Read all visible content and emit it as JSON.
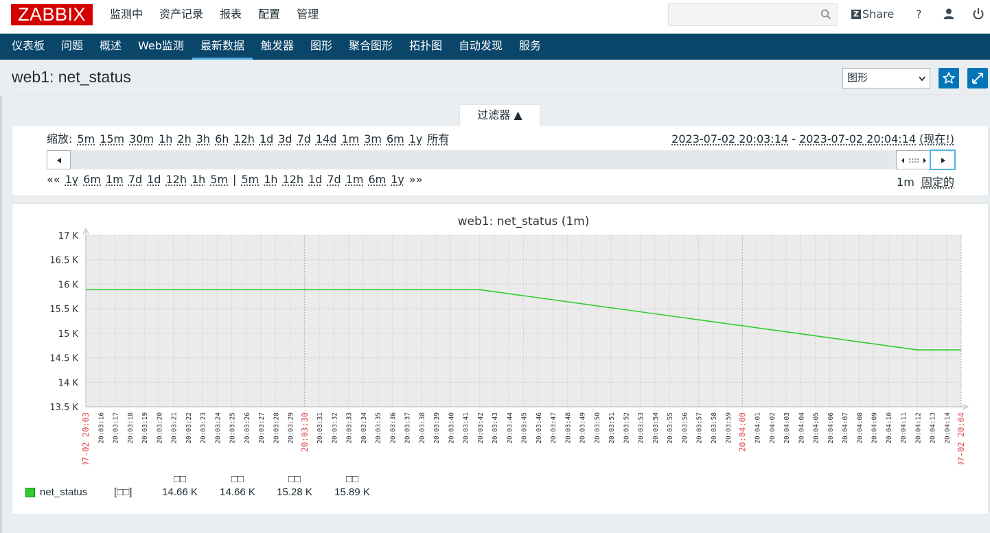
{
  "header": {
    "logo": "ZABBIX",
    "nav": [
      "监测中",
      "资产记录",
      "报表",
      "配置",
      "管理"
    ],
    "active_nav": "监测中",
    "search_placeholder": "",
    "share_label": "Share",
    "share_badge": "Z",
    "help_label": "?"
  },
  "subnav": {
    "items": [
      "仪表板",
      "问题",
      "概述",
      "Web监测",
      "最新数据",
      "触发器",
      "图形",
      "聚合图形",
      "拓扑图",
      "自动发现",
      "服务"
    ],
    "active": "最新数据"
  },
  "page": {
    "title": "web1: net_status",
    "view_select": "图形",
    "view_options": [
      "图形"
    ]
  },
  "filter": {
    "tab_label": "过滤器 ▲",
    "zoom_label": "缩放:",
    "zoom_options": [
      "5m",
      "15m",
      "30m",
      "1h",
      "2h",
      "3h",
      "6h",
      "12h",
      "1d",
      "3d",
      "7d",
      "14d",
      "1m",
      "3m",
      "6m",
      "1y",
      "所有"
    ],
    "range_from": "2023-07-02 20:03:14",
    "range_sep": "-",
    "range_to": "2023-07-02 20:04:14",
    "range_now": "(现在!)",
    "nav_back_arrows": "««",
    "nav_back": [
      "1y",
      "6m",
      "1m",
      "7d",
      "1d",
      "12h",
      "1h",
      "5m"
    ],
    "nav_sep": "|",
    "nav_fwd": [
      "5m",
      "1h",
      "12h",
      "1d",
      "7d",
      "1m",
      "6m",
      "1y"
    ],
    "nav_fwd_arrows": "»»",
    "period": "1m",
    "fixed": "固定的"
  },
  "graph": {
    "title": "web1: net_status (1m)",
    "legend": {
      "name": "net_status",
      "func": "[□□]",
      "headers": [
        "□□",
        "□□",
        "□□",
        "□□"
      ],
      "values": [
        "14.66 K",
        "14.66 K",
        "15.28 K",
        "15.89 K"
      ],
      "color": "#2ecc2e"
    }
  },
  "chart_data": {
    "type": "line",
    "title": "web1: net_status (1m)",
    "xlabel": "",
    "ylabel": "",
    "ylim": [
      13500,
      17000
    ],
    "yticks": [
      "13.5 K",
      "14 K",
      "14.5 K",
      "15 K",
      "15.5 K",
      "16 K",
      "16.5 K",
      "17 K"
    ],
    "xticks": [
      "07-02 20:03",
      "20:03:16",
      "20:03:17",
      "20:03:18",
      "20:03:19",
      "20:03:20",
      "20:03:21",
      "20:03:22",
      "20:03:23",
      "20:03:24",
      "20:03:25",
      "20:03:26",
      "20:03:27",
      "20:03:28",
      "20:03:29",
      "20:03:30",
      "20:03:31",
      "20:03:32",
      "20:03:33",
      "20:03:34",
      "20:03:35",
      "20:03:36",
      "20:03:37",
      "20:03:38",
      "20:03:39",
      "20:03:40",
      "20:03:41",
      "20:03:42",
      "20:03:43",
      "20:03:44",
      "20:03:45",
      "20:03:46",
      "20:03:47",
      "20:03:48",
      "20:03:49",
      "20:03:50",
      "20:03:51",
      "20:03:52",
      "20:03:53",
      "20:03:54",
      "20:03:55",
      "20:03:56",
      "20:03:57",
      "20:03:58",
      "20:03:59",
      "20:04:00",
      "20:04:01",
      "20:04:02",
      "20:04:03",
      "20:04:04",
      "20:04:05",
      "20:04:06",
      "20:04:07",
      "20:04:08",
      "20:04:09",
      "20:04:10",
      "20:04:11",
      "20:04:12",
      "20:04:13",
      "20:04:14",
      "07-02 20:04"
    ],
    "highlight_ticks": [
      "07-02 20:03",
      "20:03:30",
      "20:04:00",
      "07-02 20:04"
    ],
    "series": [
      {
        "name": "net_status",
        "color": "#2ecc2e",
        "x": [
          "20:03:14",
          "20:03:41",
          "20:04:11",
          "20:04:14"
        ],
        "values": [
          15890,
          15890,
          14660,
          14660
        ]
      }
    ],
    "grid": true
  }
}
